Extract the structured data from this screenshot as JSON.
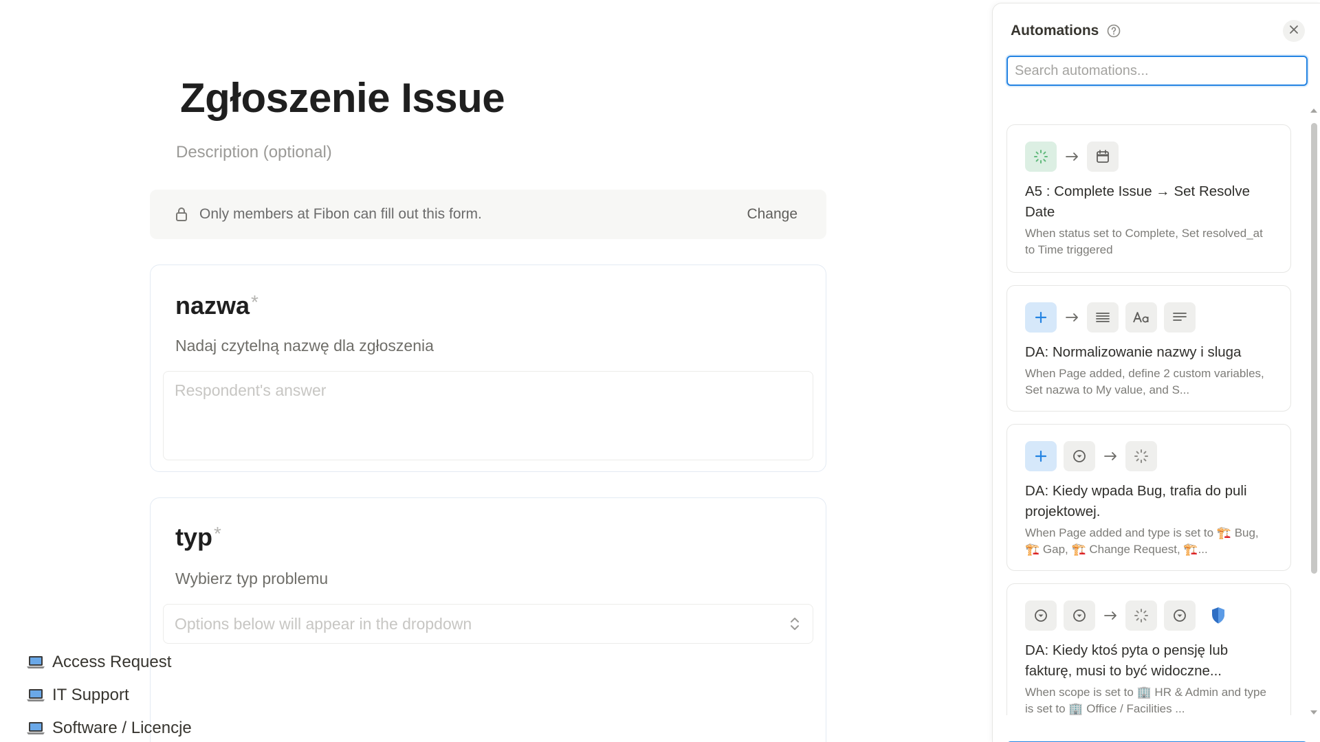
{
  "form": {
    "title": "Zgłoszenie Issue",
    "description_placeholder": "Description (optional)",
    "access": {
      "text": "Only members at Fibon can fill out this form.",
      "change_label": "Change"
    },
    "questions": [
      {
        "title": "nazwa",
        "required_mark": "*",
        "help": "Nadaj czytelną nazwę dla zgłoszenia",
        "answer_placeholder": "Respondent's answer"
      },
      {
        "title": "typ",
        "required_mark": "*",
        "help": "Wybierz typ problemu",
        "dropdown_placeholder": "Options below will appear in the dropdown",
        "options": [
          {
            "emoji": "laptop-icon",
            "label": "Access Request"
          },
          {
            "emoji": "laptop-icon",
            "label": "IT Support"
          },
          {
            "emoji": "laptop-icon",
            "label": "Software / Licencje"
          }
        ]
      }
    ]
  },
  "panel": {
    "title": "Automations",
    "search_placeholder": "Search automations...",
    "automations": [
      {
        "name": "A5 : Complete Issue → Set Resolve Date",
        "description": "When status set to Complete, Set resolved_at to Time triggered",
        "trigger_icons": [
          "status-icon"
        ],
        "action_icons": [
          "calendar-icon"
        ]
      },
      {
        "name": "DA: Normalizowanie nazwy i sluga",
        "description": "When Page added, define 2 custom variables, Set nazwa to My value, and S...",
        "trigger_icons": [
          "plus-icon"
        ],
        "action_icons": [
          "text-lines-icon",
          "text-format-icon",
          "text-align-icon"
        ]
      },
      {
        "name": "DA: Kiedy wpada Bug, trafia do puli projektowej.",
        "description": "When Page added and type is set to 🏗️ Bug, 🏗️ Gap, 🏗️ Change Request, 🏗️...",
        "trigger_icons": [
          "plus-icon",
          "select-icon"
        ],
        "action_icons": [
          "status-icon"
        ]
      },
      {
        "name": "DA: Kiedy ktoś pyta o pensję lub fakturę, musi to być widoczne...",
        "description": "When scope is set to 🏢 HR & Admin and type is set to 🏢 Office / Facilities ...",
        "trigger_icons": [
          "select-icon",
          "select-icon"
        ],
        "action_icons": [
          "status-icon",
          "select-icon",
          "shield-icon"
        ]
      }
    ]
  },
  "colors": {
    "accent": "#2383e2",
    "green_chip": "#dcefe3",
    "blue_chip": "#d6e8fa"
  }
}
